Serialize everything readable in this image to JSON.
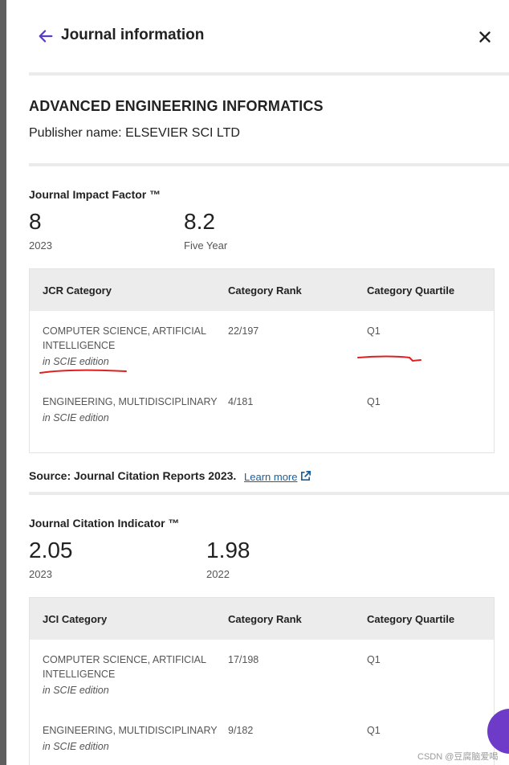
{
  "header": {
    "title": "Journal information",
    "back_icon": "arrow-left-icon",
    "close_icon": "close-icon",
    "accent": "#5b3cc4"
  },
  "journal": {
    "name": "ADVANCED ENGINEERING INFORMATICS",
    "publisher": "Publisher name: ELSEVIER SCI LTD"
  },
  "jif": {
    "title": "Journal Impact Factor ™",
    "value": "8",
    "value_label": "2023",
    "five_year_value": "8.2",
    "five_year_label": "Five Year"
  },
  "jcr_table": {
    "headers": [
      "JCR Category",
      "Category Rank",
      "Category Quartile"
    ],
    "rows": [
      {
        "category": "COMPUTER SCIENCE, ARTIFICIAL INTELLIGENCE",
        "edition": "in SCIE edition",
        "rank": "22/197",
        "quartile": "Q1"
      },
      {
        "category": "ENGINEERING, MULTIDISCIPLINARY",
        "edition": "in SCIE edition",
        "rank": "4/181",
        "quartile": "Q1"
      }
    ]
  },
  "source": {
    "text": "Source: Journal Citation Reports  2023.",
    "link": "Learn more",
    "link_icon": "external-link-icon"
  },
  "jci": {
    "title": "Journal Citation Indicator ™",
    "value": "2.05",
    "value_label": "2023",
    "prev_value": "1.98",
    "prev_label": "2022"
  },
  "jci_table": {
    "headers": [
      "JCI Category",
      "Category Rank",
      "Category Quartile"
    ],
    "rows": [
      {
        "category": "COMPUTER SCIENCE, ARTIFICIAL INTELLIGENCE",
        "edition": "in SCIE edition",
        "rank": "17/198",
        "quartile": "Q1"
      },
      {
        "category": "ENGINEERING, MULTIDISCIPLINARY",
        "edition": "in SCIE edition",
        "rank": "9/182",
        "quartile": "Q1"
      }
    ]
  },
  "watermark": "CSDN @豆腐脑爱喝",
  "annotation_color": "#e02020"
}
